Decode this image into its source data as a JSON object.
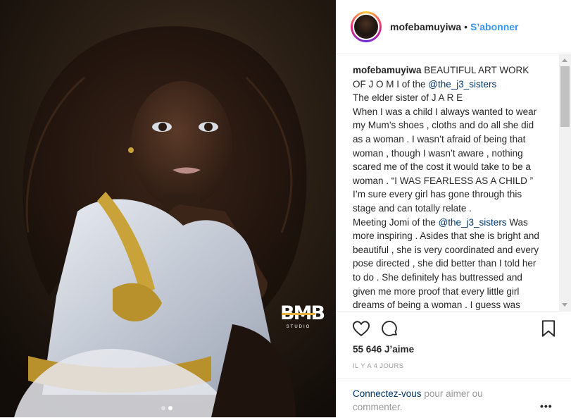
{
  "post": {
    "username": "mofebamuyiwa",
    "separator": "•",
    "follow_label": "S’abonner",
    "caption_username": "mofebamuyiwa",
    "caption_segments": {
      "part1": " BEAUTIFUL ART WORK OF J O M I of the ",
      "mention1": "@the_j3_sisters",
      "part2": "The elder sister of J A R E",
      "part3": "When I was a child I always wanted to wear my Mum’s shoes , cloths and do all she did as a woman . I wasn’t afraid of being that woman , though I wasn’t aware , nothing scared me of the cost it would take to be a woman . “I WAS FEARLESS AS A CHILD ” I’m sure every girl has gone through this stage and can totally relate .",
      "part4": "Meeting Jomi of the ",
      "mention2": "@the_j3_sisters",
      "part5": " Was more inspiring . Asides that she is bright and beautiful , she is very coordinated and every pose directed , she did better than I told her to do . She definitely has buttressed and given me more proof that every little girl dreams of being a woman . I guess was looking for a platform to showcase her inner woman !!! Photography"
    },
    "likes": "55 646 J’aime",
    "time_ago": "IL Y A 4 JOURS",
    "login_link": "Connectez-vous",
    "login_text": " pour aimer ou commenter.",
    "more_label": "•••",
    "watermark": {
      "mark": "BMB",
      "sub": "STUDIO"
    }
  },
  "icons": {
    "like": "heart-icon",
    "comment": "comment-bubble-icon",
    "save": "bookmark-icon",
    "more": "more-options-icon"
  },
  "carousel": {
    "count": 2,
    "active_index": 1
  },
  "colors": {
    "follow": "#3897f0",
    "mention": "#003569",
    "meta": "#999999",
    "border": "#efefef",
    "sequin_gold": "#c9a23a",
    "logo_gold": "#e4b23a"
  }
}
